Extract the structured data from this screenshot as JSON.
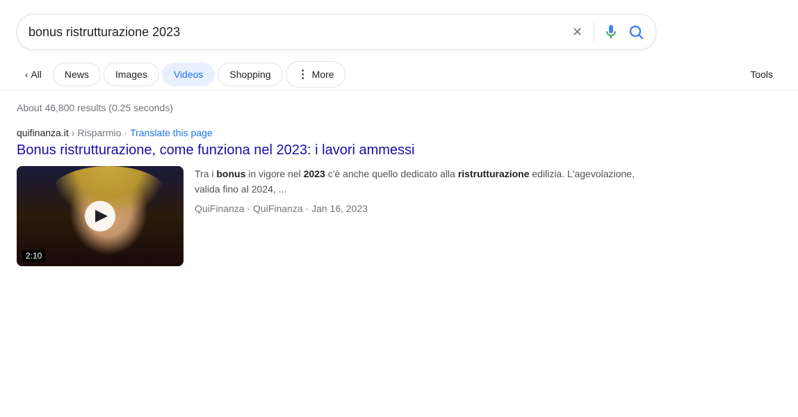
{
  "search": {
    "query": "bonus ristrutturazione 2023",
    "clear_label": "✕",
    "mic_label": "Search by voice",
    "submit_label": "Google Search"
  },
  "tabs": {
    "back_label": "All",
    "items": [
      {
        "id": "news",
        "label": "News",
        "active": false
      },
      {
        "id": "images",
        "label": "Images",
        "active": false
      },
      {
        "id": "videos",
        "label": "Videos",
        "active": true
      },
      {
        "id": "shopping",
        "label": "Shopping",
        "active": false
      },
      {
        "id": "more",
        "label": "More",
        "active": false,
        "has_dots": true
      }
    ],
    "tools_label": "Tools"
  },
  "results": {
    "stats": "About 46,800 results (0.25 seconds)",
    "items": [
      {
        "site": "quifinanza.it",
        "breadcrumb_sep": "›",
        "path": "Risparmio",
        "translate_dot": "·",
        "translate_label": "Translate this page",
        "title": "Bonus ristrutturazione, come funziona nel 2023: i lavori ammessi",
        "url": "#",
        "video_duration": "2:10",
        "snippet_parts": [
          {
            "text": "Tra i ",
            "bold": false
          },
          {
            "text": "bonus",
            "bold": true
          },
          {
            "text": " in vigore nel ",
            "bold": false
          },
          {
            "text": "2023",
            "bold": true
          },
          {
            "text": " c'è anche quello dedicato alla ",
            "bold": false
          },
          {
            "text": "ristrutturazione",
            "bold": true
          },
          {
            "text": " edilizia. L'agevolazione, valida fino al 2024, ...",
            "bold": false
          }
        ],
        "meta": "QuiFinanza · QuiFinanza · Jan 16, 2023"
      }
    ]
  }
}
